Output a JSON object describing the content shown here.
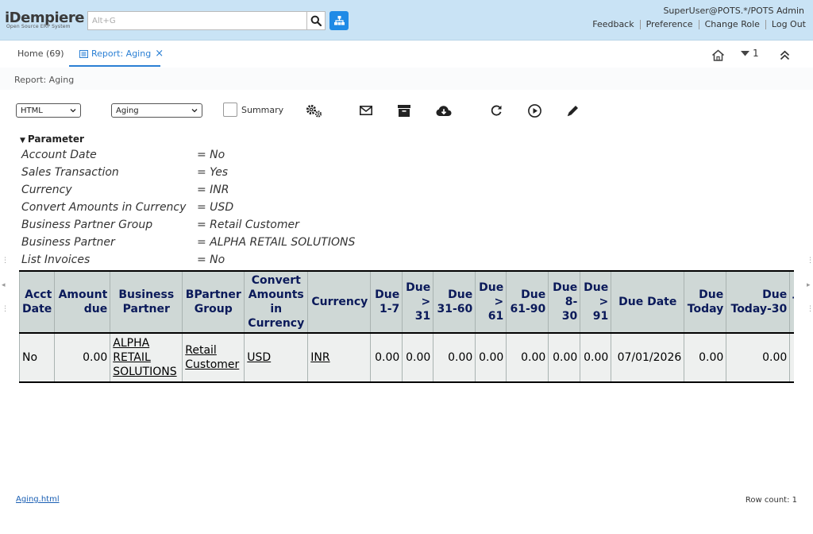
{
  "header": {
    "logo_main": "iDempiere",
    "logo_sub": "Open Source ERP System",
    "search_placeholder": "Alt+G",
    "user": "SuperUser@POTS.*/POTS Admin",
    "links": [
      "Feedback",
      "Preference",
      "Change Role",
      "Log Out"
    ]
  },
  "tabs": {
    "home_label": "Home (69)",
    "report_label": "Report: Aging",
    "close_symbol": "×",
    "dropdown_count": "1"
  },
  "breadcrumb": "Report: Aging",
  "toolbar": {
    "format_value": "HTML",
    "report_value": "Aging",
    "summary_label": "Summary"
  },
  "parameters": {
    "title": "Parameter",
    "rows": [
      {
        "name": "Account Date",
        "value": "= No"
      },
      {
        "name": "Sales Transaction",
        "value": "= Yes"
      },
      {
        "name": "Currency",
        "value": "= INR"
      },
      {
        "name": "Convert Amounts in Currency",
        "value": "= USD"
      },
      {
        "name": "Business Partner Group",
        "value": "= Retail Customer"
      },
      {
        "name": "Business Partner",
        "value": "= ALPHA RETAIL SOLUTIONS"
      },
      {
        "name": "List Invoices",
        "value": "= No"
      }
    ]
  },
  "table": {
    "headers": [
      "Acct Date",
      "Amount due",
      "Business Partner",
      "BPartner Group",
      "Convert Amounts in Currency",
      "Currency",
      "Due 1-7",
      "Due > 31",
      "Due 31-60",
      "Due > 61",
      "Due 61-90",
      "Due 8-30",
      "Due > 91",
      "Due Date",
      "Due Today",
      "Due Today-30",
      "T"
    ],
    "row": {
      "acct_date": "No",
      "amount_due": "0.00",
      "business_partner": "ALPHA RETAIL SOLUTIONS",
      "bpartner_group": "Retail Customer",
      "convert_currency": "USD",
      "currency": "INR",
      "due_1_7": "0.00",
      "due_gt_31": "0.00",
      "due_31_60": "0.00",
      "due_gt_61": "0.00",
      "due_61_90": "0.00",
      "due_8_30": "0.00",
      "due_gt_91": "0.00",
      "due_date": "07/01/2026",
      "due_today": "0.00",
      "due_today_30": "0.00"
    }
  },
  "footer": {
    "file_link": "Aging.html",
    "row_count": "Row count: 1"
  }
}
